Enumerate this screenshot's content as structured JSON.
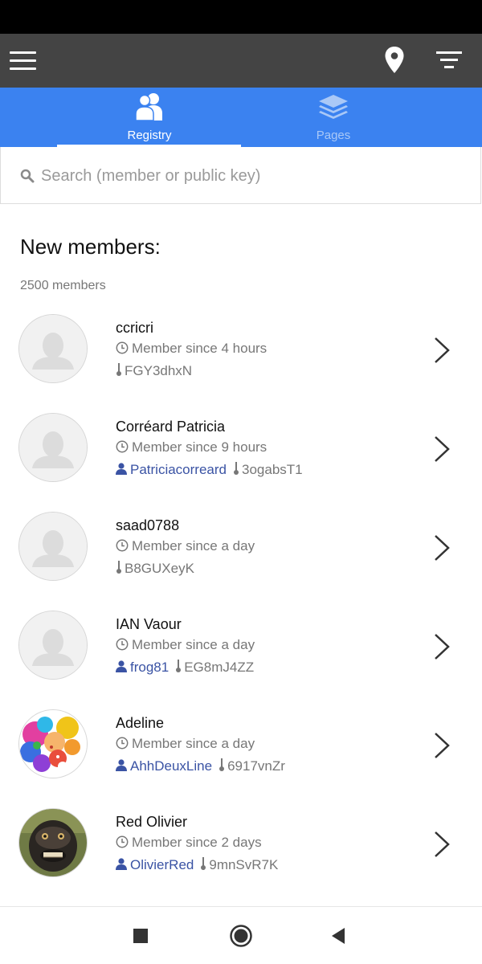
{
  "app_bar": {
    "menu_icon": "hamburger-menu-icon",
    "location_icon": "map-pin-icon",
    "filter_icon": "filter-list-icon",
    "background": "#444444"
  },
  "tabs": [
    {
      "label": "Registry",
      "icon": "people-icon",
      "active": true
    },
    {
      "label": "Pages",
      "icon": "layers-icon",
      "active": false
    }
  ],
  "accent_color": "#3b82f0",
  "search": {
    "placeholder": "Search (member or public key)",
    "value": ""
  },
  "section": {
    "title": "New members:",
    "count": "2500 members"
  },
  "members": [
    {
      "name": "ccricri",
      "since": "Member since 4 hours",
      "uid": "",
      "pubkey": "FGY3dhxN",
      "avatar": "default"
    },
    {
      "name": "Corréard Patricia",
      "since": "Member since 9 hours",
      "uid": "Patriciacorreard",
      "pubkey": "3ogabsT1",
      "avatar": "default"
    },
    {
      "name": "saad0788",
      "since": "Member since a day",
      "uid": "",
      "pubkey": "B8GUXeyK",
      "avatar": "default"
    },
    {
      "name": "IAN Vaour",
      "since": "Member since a day",
      "uid": "frog81",
      "pubkey": "EG8mJ4ZZ",
      "avatar": "default"
    },
    {
      "name": "Adeline",
      "since": "Member since a day",
      "uid": "AhhDeuxLine",
      "pubkey": "6917vnZr",
      "avatar": "painting"
    },
    {
      "name": "Red Olivier",
      "since": "Member since 2 days",
      "uid": "OlivierRed",
      "pubkey": "9mnSvR7K",
      "avatar": "monkey"
    }
  ],
  "nav_bar": {
    "recent_icon": "recent-apps-square-icon",
    "home_icon": "home-circle-icon",
    "back_icon": "back-triangle-icon"
  }
}
